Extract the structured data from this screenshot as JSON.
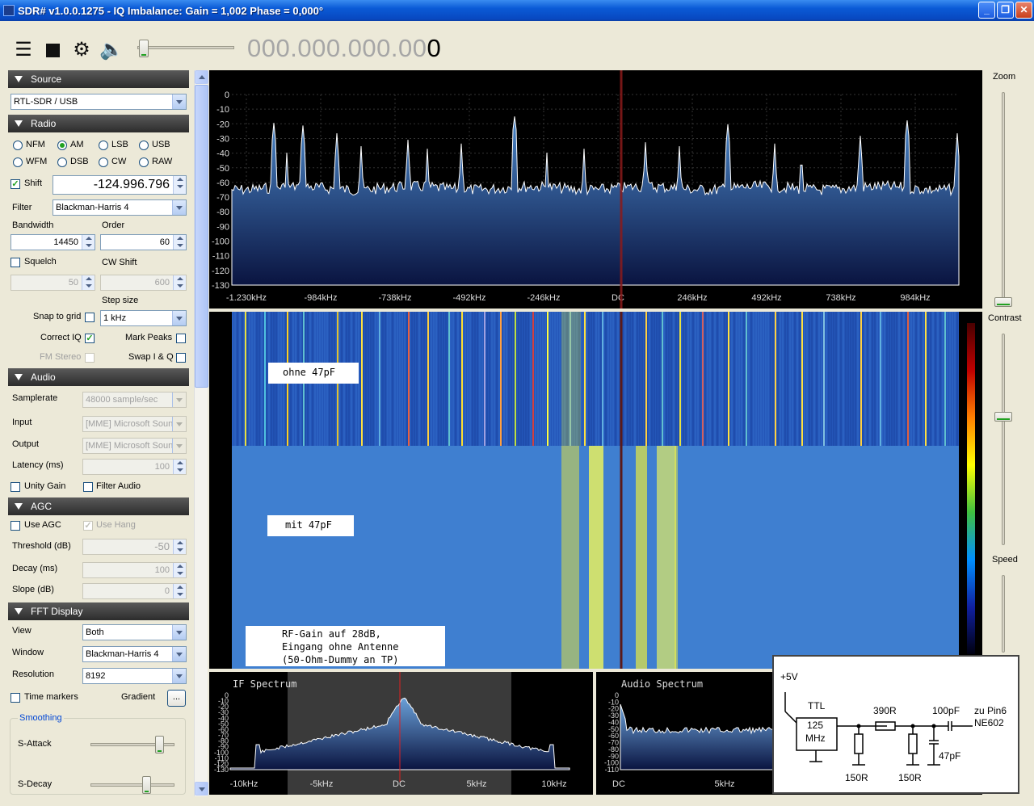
{
  "window": {
    "title": "SDR# v1.0.0.1275 - IQ Imbalance: Gain = 1,002 Phase = 0,000°"
  },
  "toolbar": {
    "frequency_gray": "000.000.000.00",
    "frequency_last": "0",
    "icons": [
      "menu-icon",
      "stop-icon",
      "gear-icon",
      "speaker-icon"
    ],
    "volume_level": 0.05
  },
  "source": {
    "header": "Source",
    "device": "RTL-SDR / USB"
  },
  "radio": {
    "header": "Radio",
    "modes": [
      "NFM",
      "AM",
      "LSB",
      "USB",
      "WFM",
      "DSB",
      "CW",
      "RAW"
    ],
    "selected_mode": "AM",
    "shift_label": "Shift",
    "shift_checked": true,
    "shift_value": "-124.996.796",
    "filter_label": "Filter",
    "filter_value": "Blackman-Harris 4",
    "bandwidth_label": "Bandwidth",
    "bandwidth_value": "14450",
    "order_label": "Order",
    "order_value": "60",
    "squelch_label": "Squelch",
    "squelch_value": "50",
    "cwshift_label": "CW Shift",
    "cwshift_value": "600",
    "stepsize_label": "Step size",
    "stepsize_value": "1 kHz",
    "snap_label": "Snap to grid",
    "correctiq_label": "Correct IQ",
    "correctiq_checked": true,
    "markpeaks_label": "Mark Peaks",
    "fmstereo_label": "FM Stereo",
    "swapiq_label": "Swap I & Q"
  },
  "audio": {
    "header": "Audio",
    "samplerate_label": "Samplerate",
    "samplerate_value": "48000 sample/sec",
    "input_label": "Input",
    "input_value": "[MME] Microsoft Soun",
    "output_label": "Output",
    "output_value": "[MME] Microsoft Soun",
    "latency_label": "Latency (ms)",
    "latency_value": "100",
    "unitygain_label": "Unity Gain",
    "filteraudio_label": "Filter Audio"
  },
  "agc": {
    "header": "AGC",
    "useagc_label": "Use AGC",
    "usehang_label": "Use Hang",
    "threshold_label": "Threshold (dB)",
    "threshold_value": "-50",
    "decay_label": "Decay (ms)",
    "decay_value": "100",
    "slope_label": "Slope (dB)",
    "slope_value": "0"
  },
  "fft": {
    "header": "FFT Display",
    "view_label": "View",
    "view_value": "Both",
    "window_label": "Window",
    "window_value": "Blackman-Harris 4",
    "resolution_label": "Resolution",
    "resolution_value": "8192",
    "timemarkers_label": "Time markers",
    "gradient_label": "Gradient",
    "gradient_button": "...",
    "smoothing_label": "Smoothing",
    "sattack_label": "S-Attack",
    "sdecay_label": "S-Decay",
    "sattack_level": 0.82,
    "sdecay_level": 0.66
  },
  "right_panel": {
    "zoom_label": "Zoom",
    "contrast_label": "Contrast",
    "speed_label": "Speed",
    "zoom_level": 0.0,
    "contrast_level": 0.63,
    "speed_level": 0.5
  },
  "spectrum": {
    "y_ticks": [
      "0",
      "-10",
      "-20",
      "-30",
      "-40",
      "-50",
      "-60",
      "-70",
      "-80",
      "-90",
      "-100",
      "-110",
      "-120",
      "-130"
    ],
    "x_ticks": [
      "-1.230kHz",
      "-984kHz",
      "-738kHz",
      "-492kHz",
      "-246kHz",
      "DC",
      "246kHz",
      "492kHz",
      "738kHz",
      "984kHz"
    ]
  },
  "waterfall": {
    "note1": "ohne 47pF",
    "note2": "mit 47pF",
    "note3_line1": "RF-Gain auf 28dB,",
    "note3_line2": "Eingang ohne Antenne",
    "note3_line3": "(50-Ohm-Dummy an TP)"
  },
  "if_spectrum": {
    "title": "IF Spectrum",
    "y_ticks": [
      "0",
      "-10",
      "-20",
      "-30",
      "-40",
      "-50",
      "-60",
      "-70",
      "-80",
      "-90",
      "-100",
      "-110",
      "-120",
      "-130"
    ],
    "x_ticks": [
      "-10kHz",
      "-5kHz",
      "DC",
      "5kHz",
      "10kHz"
    ]
  },
  "audio_spectrum": {
    "title": "Audio Spectrum",
    "y_ticks": [
      "0",
      "-10",
      "-20",
      "-30",
      "-40",
      "-50",
      "-60",
      "-70",
      "-80",
      "-90",
      "-100",
      "-110"
    ],
    "x_ticks": [
      "DC",
      "5kHz"
    ]
  },
  "circuit": {
    "vcc": "+5V",
    "ttl": "TTL",
    "osc_line1": "125",
    "osc_line2": "MHz",
    "r1": "390R",
    "c1": "100pF",
    "out_line1": "zu Pin6",
    "out_line2": "NE602",
    "r2": "150R",
    "r3": "150R",
    "c2": "47pF"
  }
}
